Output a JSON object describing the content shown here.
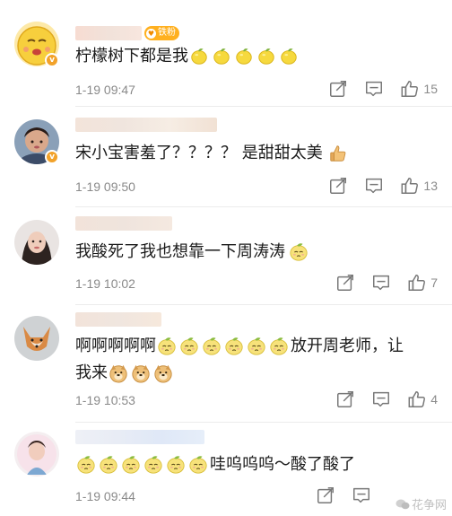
{
  "comments": [
    {
      "text": "柠檬树下都是我",
      "emojis": [
        "lemon-emoji",
        "lemon-emoji",
        "lemon-emoji",
        "lemon-emoji",
        "lemon-emoji"
      ],
      "time": "1-19 09:47",
      "likes": "15",
      "badge": "铁粉",
      "verified": true
    },
    {
      "text": "宋小宝害羞了？？？？ 是甜甜太美",
      "emojis": [
        "thumbs-up-emoji"
      ],
      "time": "1-19 09:50",
      "likes": "13",
      "verified": true
    },
    {
      "text": "我酸死了我也想靠一下周涛涛",
      "emojis": [
        "sour-lemon-face-emoji"
      ],
      "time": "1-19 10:02",
      "likes": "7"
    },
    {
      "text_before": "啊啊啊啊啊",
      "text_after": "放开周老师，让",
      "text_line2": "我来",
      "emojis": [
        "sour-lemon-face-emoji",
        "sour-lemon-face-emoji",
        "sour-lemon-face-emoji",
        "sour-lemon-face-emoji",
        "sour-lemon-face-emoji",
        "sour-lemon-face-emoji"
      ],
      "emojis_line2": [
        "doge-emoji",
        "doge-emoji",
        "doge-emoji"
      ],
      "time": "1-19 10:53",
      "likes": "4"
    },
    {
      "text": "哇呜呜呜～酸了酸了",
      "emojis": [
        "sour-lemon-face-emoji",
        "sour-lemon-face-emoji",
        "sour-lemon-face-emoji",
        "sour-lemon-face-emoji",
        "sour-lemon-face-emoji",
        "sour-lemon-face-emoji"
      ],
      "time": "1-19 09:44"
    }
  ],
  "watermark": "花争网",
  "colors": {
    "lemon": "#f3d43a",
    "lemon_dark": "#9bbf3a",
    "fan_badge": "#ffb01f",
    "meta_gray": "#8a8a8a"
  }
}
